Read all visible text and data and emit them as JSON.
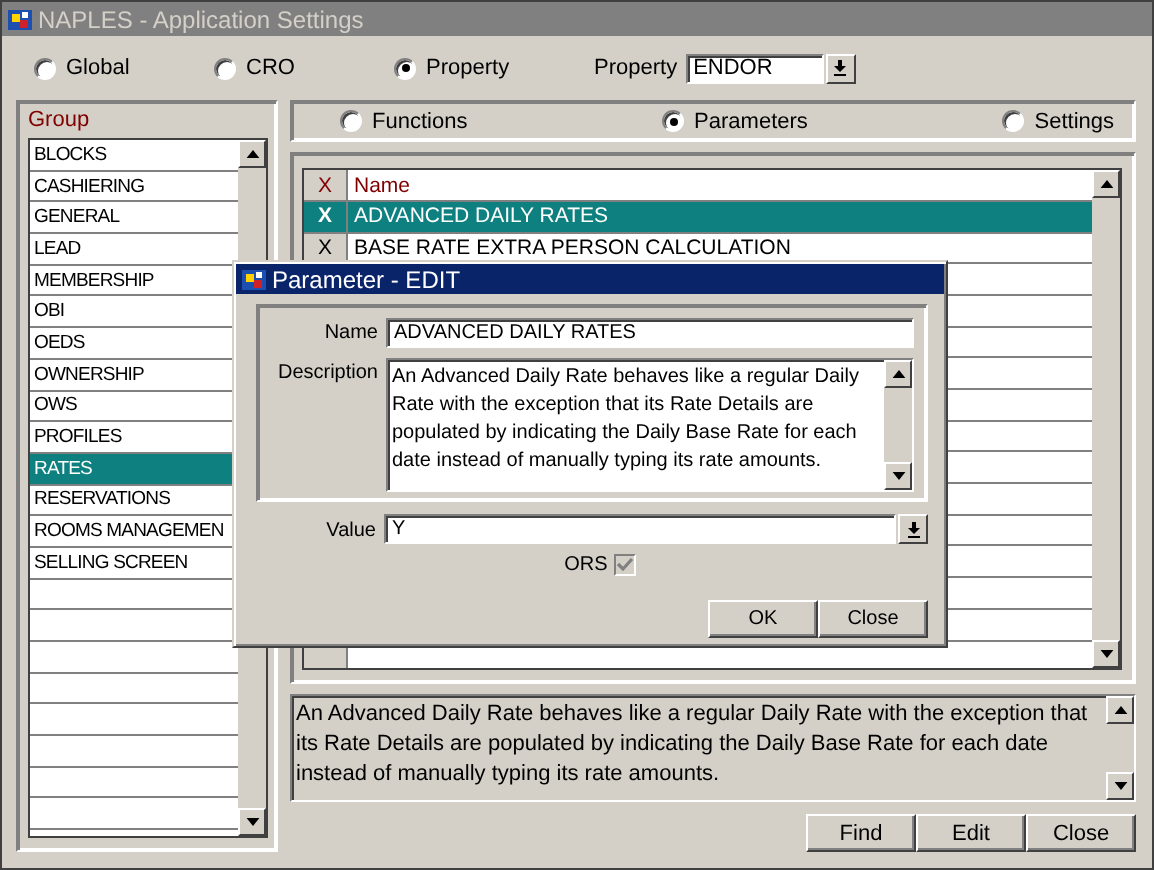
{
  "window": {
    "title": "NAPLES - Application Settings"
  },
  "scope_options": [
    {
      "label": "Global",
      "selected": false
    },
    {
      "label": "CRO",
      "selected": false
    },
    {
      "label": "Property",
      "selected": true
    }
  ],
  "property": {
    "label": "Property",
    "value": "ENDOR"
  },
  "group": {
    "label": "Group",
    "items": [
      {
        "label": "BLOCKS",
        "selected": false
      },
      {
        "label": "CASHIERING",
        "selected": false
      },
      {
        "label": "GENERAL",
        "selected": false
      },
      {
        "label": "LEAD",
        "selected": false
      },
      {
        "label": "MEMBERSHIP",
        "selected": false
      },
      {
        "label": "OBI",
        "selected": false
      },
      {
        "label": "OEDS",
        "selected": false
      },
      {
        "label": "OWNERSHIP",
        "selected": false
      },
      {
        "label": "OWS",
        "selected": false
      },
      {
        "label": "PROFILES",
        "selected": false
      },
      {
        "label": "RATES",
        "selected": true
      },
      {
        "label": "RESERVATIONS",
        "selected": false
      },
      {
        "label": "ROOMS MANAGEMEN",
        "selected": false
      },
      {
        "label": "SELLING SCREEN",
        "selected": false
      }
    ]
  },
  "view_options": [
    {
      "label": "Functions",
      "selected": false
    },
    {
      "label": "Parameters",
      "selected": true
    },
    {
      "label": "Settings",
      "selected": false
    }
  ],
  "table": {
    "columns": [
      "X",
      "Name"
    ],
    "rows": [
      {
        "x": "X",
        "name": "ADVANCED DAILY RATES",
        "selected": true
      },
      {
        "x": "X",
        "name": "BASE RATE EXTRA PERSON CALCULATION",
        "selected": false
      }
    ]
  },
  "description": "An Advanced Daily Rate behaves like a regular Daily Rate with the exception that its Rate Details are populated by indicating the Daily Base Rate for each date instead of manually typing its rate amounts.",
  "buttons": [
    "Find",
    "Edit",
    "Close"
  ],
  "dialog": {
    "title": "Parameter - EDIT",
    "name_label": "Name",
    "name": "ADVANCED DAILY RATES",
    "description_label": "Description",
    "description": "An Advanced Daily Rate behaves like a regular Daily Rate with the exception that its Rate Details are populated by indicating the Daily Base Rate for each date instead of manually typing its rate amounts.",
    "value_label": "Value",
    "value": "Y",
    "ors": {
      "label": "ORS",
      "checked": true,
      "disabled": true
    },
    "buttons": [
      "OK",
      "Close"
    ]
  }
}
